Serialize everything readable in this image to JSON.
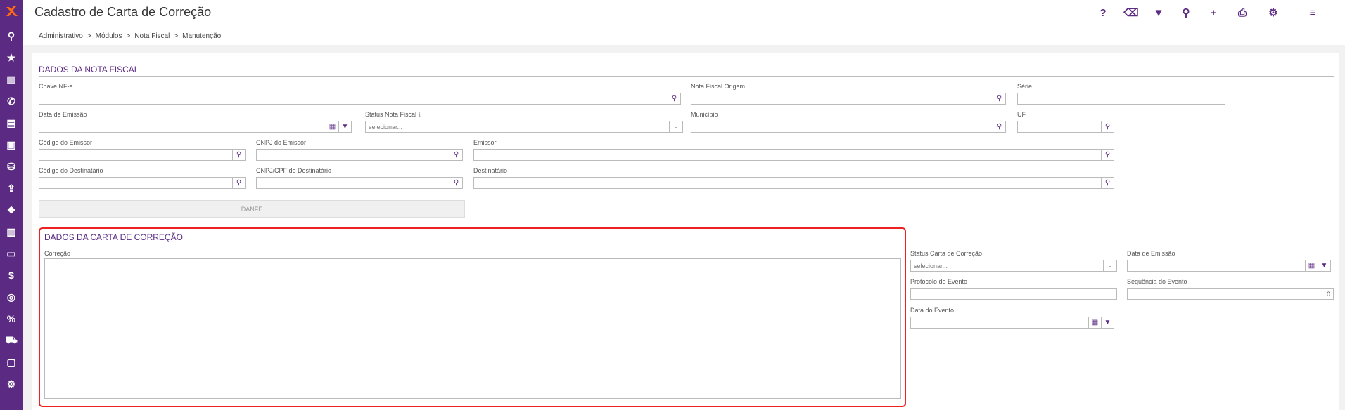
{
  "app": {
    "title": "Cadastro de Carta de Correção",
    "brand_color": "#5b2a83",
    "accent_color": "#ff6a13"
  },
  "breadcrumb": [
    "Administrativo",
    "Módulos",
    "Nota Fiscal",
    "Manutenção"
  ],
  "breadcrumb_separator": ">",
  "toolbar": {
    "items": [
      {
        "name": "help-icon",
        "glyph": "?"
      },
      {
        "name": "eraser-icon",
        "glyph": "⌫"
      },
      {
        "name": "filter-icon",
        "glyph": "▼"
      },
      {
        "name": "search-icon",
        "glyph": "⚲"
      },
      {
        "name": "add-icon",
        "glyph": "+"
      },
      {
        "name": "print-icon",
        "glyph": "⎙"
      },
      {
        "name": "gear-icon",
        "glyph": "⚙"
      },
      {
        "name": "menu-icon",
        "glyph": "≡"
      }
    ]
  },
  "sidebar": {
    "items": [
      {
        "name": "search-icon",
        "glyph": "⚲"
      },
      {
        "name": "star-icon",
        "glyph": "★"
      },
      {
        "name": "bar-chart-icon",
        "glyph": "▥"
      },
      {
        "name": "phone-icon",
        "glyph": "✆"
      },
      {
        "name": "list-icon",
        "glyph": "▤"
      },
      {
        "name": "address-book-icon",
        "glyph": "▣"
      },
      {
        "name": "basket-icon",
        "glyph": "⛁"
      },
      {
        "name": "upload-icon",
        "glyph": "⇪"
      },
      {
        "name": "dropbox-icon",
        "glyph": "❖"
      },
      {
        "name": "bar-chart-icon",
        "glyph": "▥"
      },
      {
        "name": "monitor-icon",
        "glyph": "▭"
      },
      {
        "name": "dollar-icon",
        "glyph": "$"
      },
      {
        "name": "coins-icon",
        "glyph": "◎"
      },
      {
        "name": "percent-icon",
        "glyph": "%"
      },
      {
        "name": "cart-icon",
        "glyph": "⛟"
      },
      {
        "name": "contact-card-icon",
        "glyph": "▢"
      },
      {
        "name": "cogs-icon",
        "glyph": "⚙"
      }
    ]
  },
  "nota_fiscal": {
    "section_title": "DADOS DA NOTA FISCAL",
    "chave_label": "Chave NF-e",
    "chave_value": "",
    "nf_origem_label": "Nota Fiscal Origem",
    "nf_origem_value": "",
    "serie_label": "Série",
    "serie_value": "",
    "data_emissao_label": "Data de Emissão",
    "data_emissao_value": "",
    "status_label": "Status Nota Fiscal",
    "status_placeholder": "selecionar...",
    "municipio_label": "Município",
    "municipio_value": "",
    "uf_label": "UF",
    "uf_value": "",
    "cod_emissor_label": "Código do Emissor",
    "cnpj_emissor_label": "CNPJ do Emissor",
    "emissor_label": "Emissor",
    "cod_dest_label": "Código do Destinatário",
    "cnpj_dest_label": "CNPJ/CPF do Destinatário",
    "destinatario_label": "Destinatário",
    "danfe_label": "DANFE"
  },
  "carta": {
    "section_title": "DADOS DA CARTA DE CORREÇÃO",
    "correcao_label": "Correção",
    "correcao_value": "",
    "status_label": "Status Carta de Correção",
    "status_placeholder": "selecionar...",
    "data_emissao_label": "Data de Emissão",
    "protocolo_label": "Protocolo do Evento",
    "sequencia_label": "Sequência do Evento",
    "sequencia_value": "0",
    "data_evento_label": "Data do Evento"
  }
}
